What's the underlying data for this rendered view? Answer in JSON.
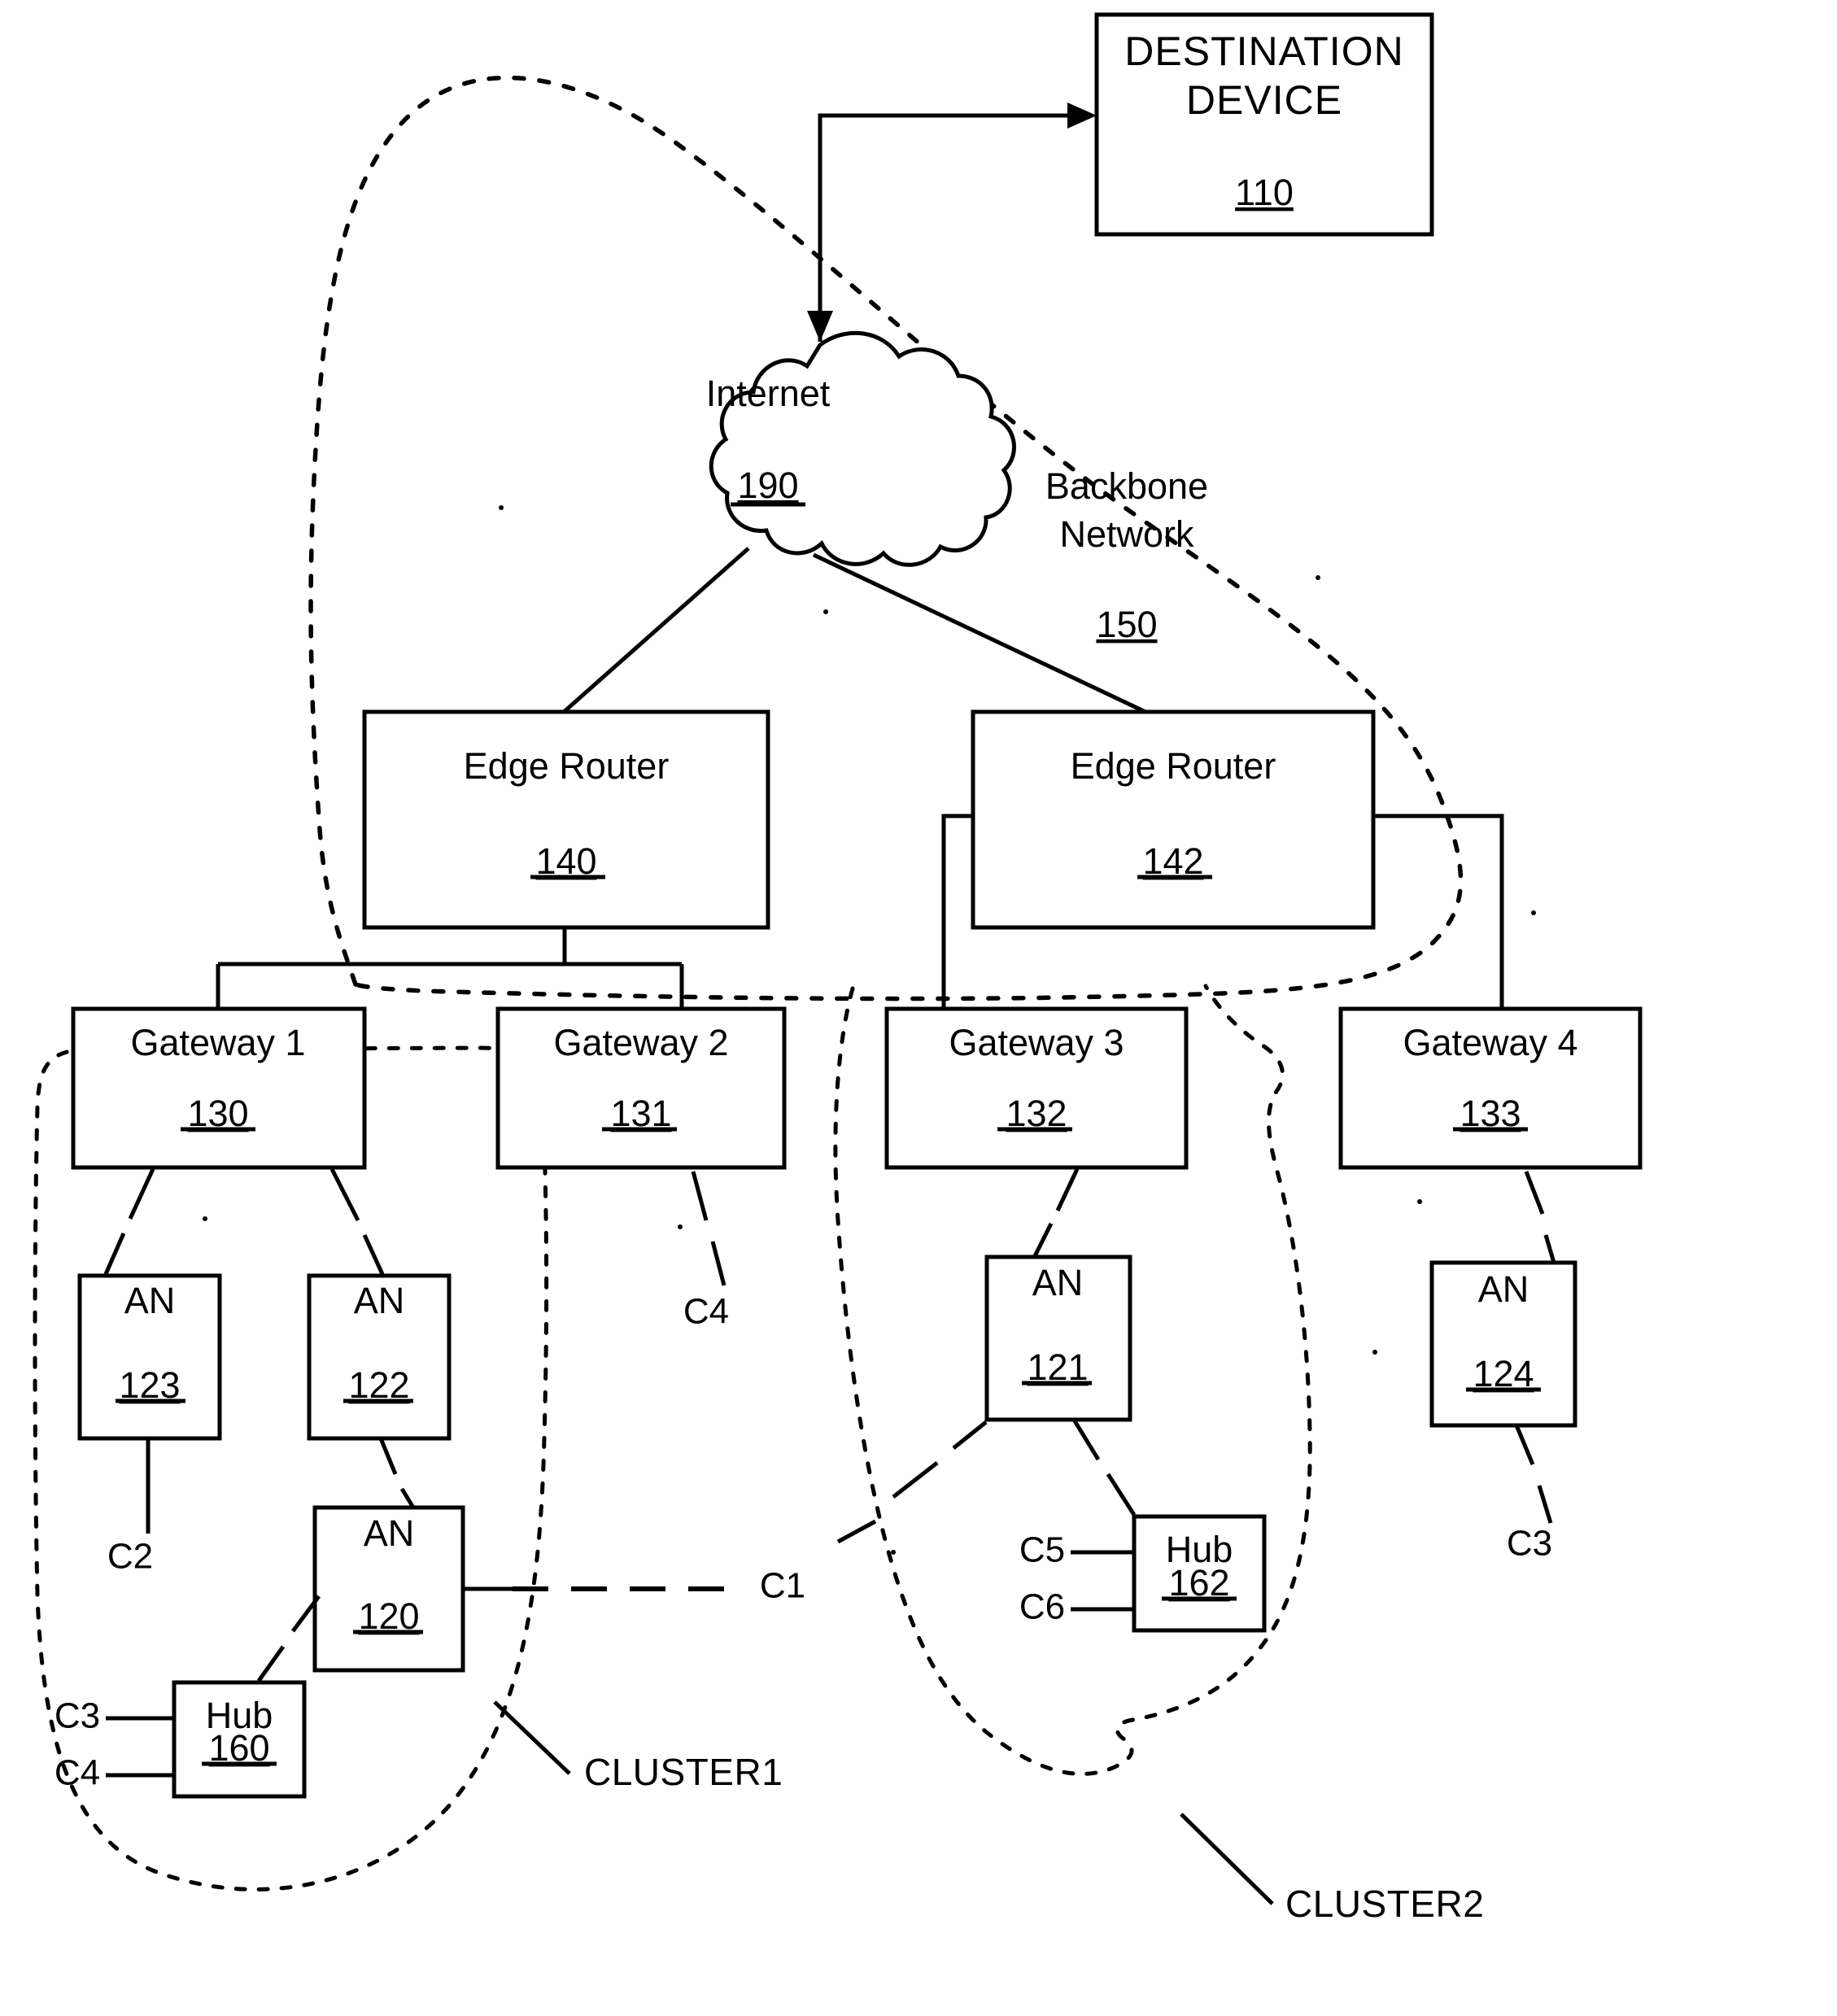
{
  "figure": {
    "type": "network-topology-patent-diagram",
    "background": "#ffffff",
    "line_color": "#000000"
  },
  "destination": {
    "title_line1": "DESTINATION",
    "title_line2": "DEVICE",
    "ref": "110"
  },
  "internet": {
    "label": "Internet",
    "ref": "190"
  },
  "backbone": {
    "label_line1": "Backbone",
    "label_line2": "Network",
    "ref": "150"
  },
  "edge_routers": [
    {
      "label": "Edge Router",
      "ref": "140"
    },
    {
      "label": "Edge Router",
      "ref": "142"
    }
  ],
  "gateways": [
    {
      "label": "Gateway 1",
      "ref": "130"
    },
    {
      "label": "Gateway 2",
      "ref": "131"
    },
    {
      "label": "Gateway 3",
      "ref": "132"
    },
    {
      "label": "Gateway 4",
      "ref": "133"
    }
  ],
  "access_nodes": [
    {
      "label": "AN",
      "ref": "123"
    },
    {
      "label": "AN",
      "ref": "122"
    },
    {
      "label": "AN",
      "ref": "120"
    },
    {
      "label": "AN",
      "ref": "121"
    },
    {
      "label": "AN",
      "ref": "124"
    }
  ],
  "hubs": [
    {
      "label": "Hub",
      "ref": "160"
    },
    {
      "label": "Hub",
      "ref": "162"
    }
  ],
  "clients": {
    "c1": "C1",
    "c2": "C2",
    "c3_hub160": "C3",
    "c4_hub160": "C4",
    "c4_gateway2": "C4",
    "c3_an124": "C3",
    "c5": "C5",
    "c6": "C6"
  },
  "clusters": [
    {
      "label": "CLUSTER1"
    },
    {
      "label": "CLUSTER2"
    }
  ]
}
